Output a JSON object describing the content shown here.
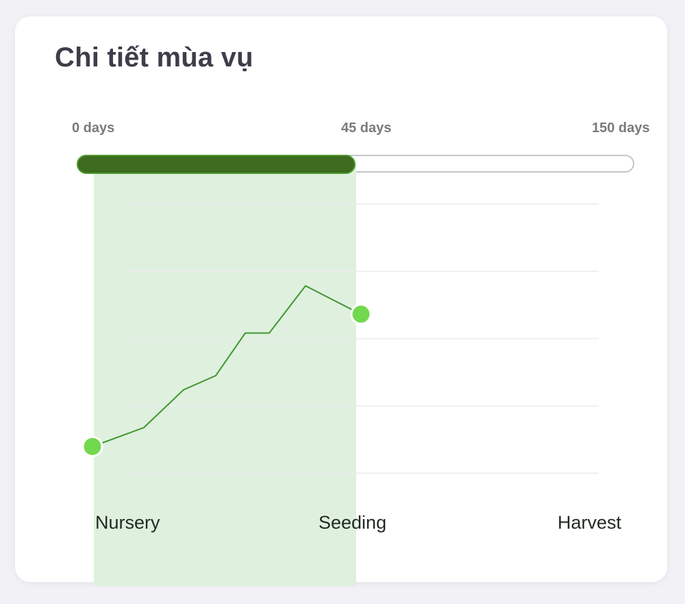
{
  "card": {
    "title": "Chi tiết mùa vụ"
  },
  "timeline": {
    "labels": [
      "0 days",
      "45 days",
      "150 days"
    ],
    "progress_fraction": 0.5,
    "colors": {
      "progress_fill": "#3d6b1f",
      "progress_track": "#c6c6c6",
      "highlight": "#dff0df",
      "line": "#3f962d",
      "marker": "#72d84e"
    }
  },
  "stages": [
    "Nursery",
    "Seeding",
    "Harvest"
  ],
  "chart_data": {
    "type": "line",
    "grid": true,
    "series": [
      {
        "values": [
          20,
          24,
          32,
          35,
          44,
          44,
          54,
          48
        ]
      }
    ],
    "ylim": [
      0,
      100
    ],
    "highlight_stage": "Nursery"
  }
}
